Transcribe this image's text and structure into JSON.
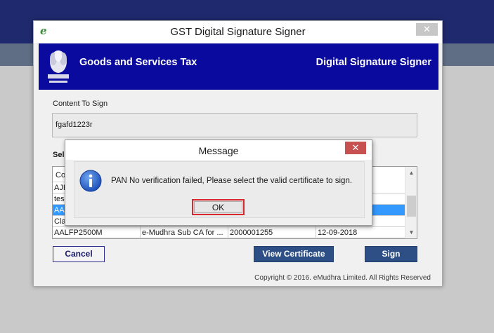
{
  "window": {
    "title": "GST Digital Signature Signer",
    "close_glyph": "✕",
    "logo_glyph": "e"
  },
  "banner": {
    "left_title": "Goods and Services Tax",
    "right_title": "Digital Signature Signer"
  },
  "content": {
    "label": "Content To Sign",
    "value": "fgafd1223r"
  },
  "certificates": {
    "label_partial": "Sele",
    "header_partial": "Co",
    "rows": [
      {
        "c1": "AJI",
        "c2": "",
        "c3": "",
        "c4": ""
      },
      {
        "c1": "tes",
        "c2": "",
        "c3": "",
        "c4": ""
      },
      {
        "c1": "AA",
        "c2": "",
        "c3": "",
        "c4": ""
      },
      {
        "c1": "Cla",
        "c2": "",
        "c3": "",
        "c4": ""
      },
      {
        "c1": "AALFP2500M",
        "c2": "e-Mudhra Sub CA for ...",
        "c3": "2000001255",
        "c4": "12-09-2018"
      }
    ],
    "selected_row": 2
  },
  "buttons": {
    "cancel": "Cancel",
    "view_certificate": "View Certificate",
    "sign": "Sign"
  },
  "footer": {
    "copyright": "Copyright © 2016. eMudhra Limited. All Rights Reserved"
  },
  "dialog": {
    "title": "Message",
    "message": "PAN No verification failed, Please select the valid certificate to sign.",
    "ok": "OK",
    "close_glyph": "✕",
    "icon": "info-icon"
  },
  "colors": {
    "banner": "#0a0a9e",
    "button_primary": "#2d4f86",
    "selection": "#3399ff",
    "ok_highlight": "#d9282f",
    "dialog_close": "#c75050"
  }
}
